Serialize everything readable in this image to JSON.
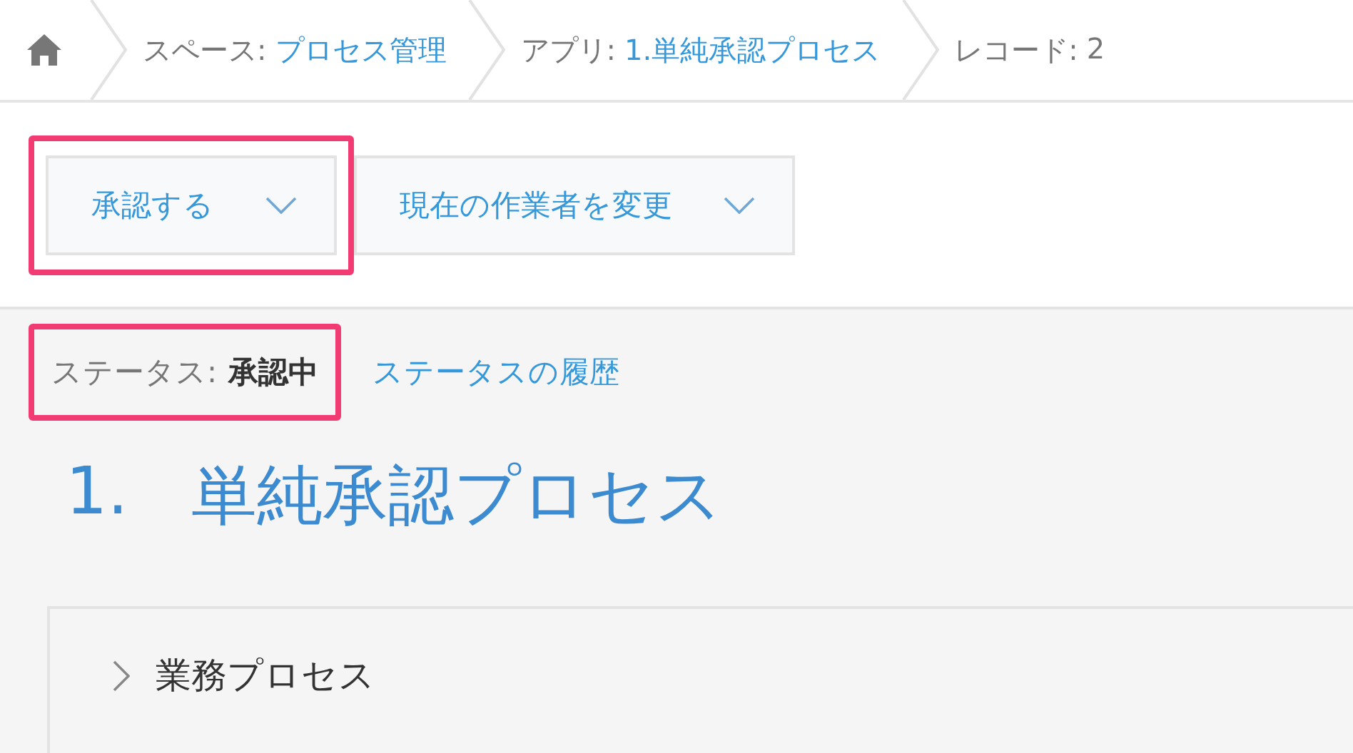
{
  "breadcrumb": [
    {
      "label": "スペース:",
      "value": "プロセス管理",
      "link": true
    },
    {
      "label": "アプリ:",
      "value": "1.単純承認プロセス",
      "link": true
    },
    {
      "label": "レコード:",
      "value": "2",
      "link": false
    }
  ],
  "actions": [
    {
      "label": "承認する",
      "highlighted": true
    },
    {
      "label": "現在の作業者を変更",
      "highlighted": false
    }
  ],
  "status": {
    "label": "ステータス:",
    "value": "承認中",
    "highlighted": true,
    "history_link": "ステータスの履歴"
  },
  "title_number": "1.",
  "title": "単純承認プロセス",
  "section": {
    "label": "業務プロセス",
    "expanded": false
  }
}
